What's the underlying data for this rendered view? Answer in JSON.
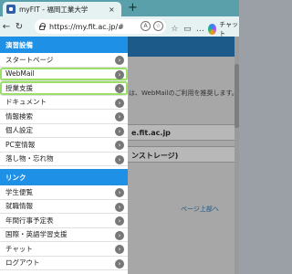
{
  "browser": {
    "tab_title": "myFIT - 福岡工業大学",
    "tab_close": "×",
    "new_tab": "+",
    "url": "https://my.fit.ac.jp/#",
    "chat_label": "チャット"
  },
  "page": {
    "notice": "は、WebMailのご利用を推奨します。",
    "box1": "e.fit.ac.jp",
    "box2": "ンストレージ)",
    "page_top": "ページ上部へ"
  },
  "menu": {
    "section1_title": "演習設備",
    "section1_items": [
      "スタートページ",
      "WebMail",
      "授業支援",
      "ドキュメント",
      "情報検索",
      "個人設定",
      "PC室情報",
      "落し物・忘れ物"
    ],
    "section2_title": "リンク",
    "section2_items": [
      "学生便覧",
      "就職情報",
      "年間行事予定表",
      "国際・英語学習支援",
      "チャット",
      "ログアウト"
    ],
    "arrow_glyph": "›"
  }
}
